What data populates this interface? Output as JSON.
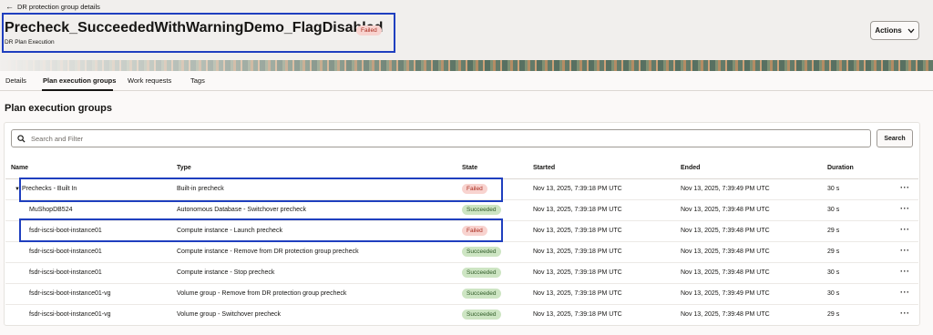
{
  "breadcrumb": {
    "back_label": "DR protection group details"
  },
  "page": {
    "title": "Precheck_SucceededWithWarningDemo_FlagDisabled",
    "status": "Failed",
    "subtitle": "DR Plan Execution",
    "actions_label": "Actions"
  },
  "tabs": [
    "Details",
    "Plan execution groups",
    "Work requests",
    "Tags"
  ],
  "active_tab": "Plan execution groups",
  "section": {
    "title": "Plan execution groups"
  },
  "search": {
    "placeholder": "Search and Filter",
    "value": "",
    "button_label": "Search"
  },
  "table": {
    "headers": [
      "Name",
      "Type",
      "State",
      "Started",
      "Ended",
      "Duration"
    ],
    "rows": [
      {
        "name": "Prechecks - Built In",
        "type": "Built-in precheck",
        "state": "Failed",
        "started": "Nov 13, 2025, 7:39:18 PM UTC",
        "ended": "Nov 13, 2025, 7:39:49 PM UTC",
        "duration": "30 s"
      },
      {
        "name": "MuShopDB524",
        "type": "Autonomous Database - Switchover precheck",
        "state": "Succeeded",
        "started": "Nov 13, 2025, 7:39:18 PM UTC",
        "ended": "Nov 13, 2025, 7:39:48 PM UTC",
        "duration": "30 s"
      },
      {
        "name": "fsdr-iscsi-boot-instance01",
        "type": "Compute instance - Launch precheck",
        "state": "Failed",
        "started": "Nov 13, 2025, 7:39:18 PM UTC",
        "ended": "Nov 13, 2025, 7:39:48 PM UTC",
        "duration": "29 s"
      },
      {
        "name": "fsdr-iscsi-boot-instance01",
        "type": "Compute instance - Remove from DR protection group precheck",
        "state": "Succeeded",
        "started": "Nov 13, 2025, 7:39:18 PM UTC",
        "ended": "Nov 13, 2025, 7:39:48 PM UTC",
        "duration": "29 s"
      },
      {
        "name": "fsdr-iscsi-boot-instance01",
        "type": "Compute instance - Stop precheck",
        "state": "Succeeded",
        "started": "Nov 13, 2025, 7:39:18 PM UTC",
        "ended": "Nov 13, 2025, 7:39:48 PM UTC",
        "duration": "30 s"
      },
      {
        "name": "fsdr-iscsi-boot-instance01-vg",
        "type": "Volume group - Remove from DR protection group precheck",
        "state": "Succeeded",
        "started": "Nov 13, 2025, 7:39:18 PM UTC",
        "ended": "Nov 13, 2025, 7:39:49 PM UTC",
        "duration": "30 s"
      },
      {
        "name": "fsdr-iscsi-boot-instance01-vg",
        "type": "Volume group - Switchover precheck",
        "state": "Succeeded",
        "started": "Nov 13, 2025, 7:39:18 PM UTC",
        "ended": "Nov 13, 2025, 7:39:48 PM UTC",
        "duration": "29 s"
      }
    ]
  },
  "icons": {
    "back": "arrow-left-icon",
    "actions": "chevron-down-icon",
    "search": "search-icon",
    "expand": "caret-down-icon",
    "row_menu": "more-icon"
  },
  "colors": {
    "failed_bg": "#f8d3cf",
    "failed_text": "#a82a1d",
    "succeeded_bg": "#cde5c3",
    "succeeded_text": "#2f5b27",
    "highlight": "#1f3fbf"
  }
}
